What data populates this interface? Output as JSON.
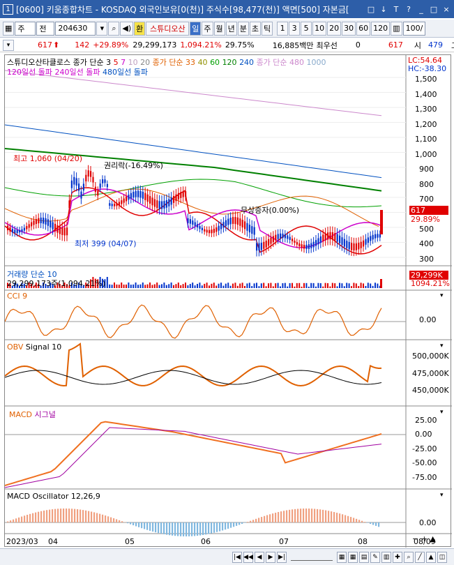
{
  "window": {
    "icon_label": "1",
    "title": "[0600] 키움종합차트 - KOSDAQ 외국인보유[0(천)] 주식수[98,477(천)] 액면[500] 자본금[",
    "buttons": [
      "□",
      "↓",
      "T",
      "?",
      "_",
      "□",
      "×"
    ]
  },
  "toolbar": {
    "period_type": "주",
    "market": "전",
    "code": "204630",
    "hwan_label": "환",
    "stock_name": "스튜디오산",
    "intervals": [
      "일",
      "주",
      "월",
      "년",
      "분",
      "초",
      "틱"
    ],
    "active_interval": "일",
    "minute_options": [
      "1",
      "3",
      "5",
      "10",
      "20",
      "30",
      "60",
      "120"
    ],
    "count_value": "100/"
  },
  "quote": {
    "price": "617",
    "change": "142",
    "change_pct": "+29.89%",
    "volume": "29,299,173",
    "volume_pct": "1,094.21%",
    "turnover": "29.75%",
    "amount": "16,885백만",
    "preferred_label": "최우선",
    "preferred_value": "0",
    "price2": "617",
    "open_label": "시",
    "open_value": "479",
    "high_label": "고"
  },
  "price_panel": {
    "legend_line1": [
      {
        "text": "스튜디오산타클로스",
        "color": "#000000"
      },
      {
        "text": "종가 단순 3",
        "color": "#000000"
      },
      {
        "text": "5",
        "color": "#e00000"
      },
      {
        "text": "7",
        "color": "#cc00cc"
      },
      {
        "text": "10",
        "color": "#c0a0c0"
      },
      {
        "text": "20",
        "color": "#888888"
      },
      {
        "text": "종가 단순 33",
        "color": "#e06000"
      },
      {
        "text": "40",
        "color": "#909000"
      },
      {
        "text": "60",
        "color": "#00a000"
      },
      {
        "text": "120",
        "color": "#008000"
      },
      {
        "text": "240",
        "color": "#0050c0"
      },
      {
        "text": "종가 단순 480",
        "color": "#cc88cc"
      },
      {
        "text": "1000",
        "color": "#88aacc"
      }
    ],
    "legend_line2": [
      {
        "text": "120일선 돌파",
        "color": "#cc00cc"
      },
      {
        "text": "240일선 돌파",
        "color": "#cc00cc"
      },
      {
        "text": "480일선 돌파",
        "color": "#0050c0"
      }
    ],
    "lc": "LC:54.64",
    "hc": "HC:-38.30",
    "annotation_high": "최고 1,060 (04/20)",
    "annotation_low": "최저 399 (04/07)",
    "annotation_rights": "권리락(-16.49%)",
    "annotation_capital": "무상증자(0.00%)",
    "current_price_tag": "617",
    "current_pct_tag": "29.89%",
    "y_ticks": [
      "1,500",
      "1,400",
      "1,300",
      "1,200",
      "1,100",
      "1,000",
      "900",
      "800",
      "700",
      "500",
      "400",
      "300"
    ]
  },
  "volume_panel": {
    "title": "거래량 단순 10",
    "value_text": "29,299,173주(1,094.21%)",
    "tag_value": "29,299K",
    "tag_pct": "1094.21%"
  },
  "cci_panel": {
    "title": "CCI 9",
    "y_ticks": [
      "0.00"
    ]
  },
  "obv_panel": {
    "title": "OBV",
    "signal": "Signal 10",
    "y_ticks": [
      "500,000K",
      "475,000K",
      "450,000K"
    ]
  },
  "macd_panel": {
    "title": "MACD",
    "signal": "시그널",
    "y_ticks": [
      "25.00",
      "0.00",
      "-25.00",
      "-50.00",
      "-75.00"
    ]
  },
  "osc_panel": {
    "title": "MACD Oscillator 12,26,9",
    "y_ticks": [
      "0.00"
    ]
  },
  "x_axis": {
    "labels": [
      "2023/03",
      "04",
      "05",
      "06",
      "07",
      "08"
    ],
    "right_label": "08/09"
  },
  "colors": {
    "title_bg": "#2d5ea8",
    "up": "#e00000",
    "down": "#0033cc",
    "orange": "#f07020"
  }
}
